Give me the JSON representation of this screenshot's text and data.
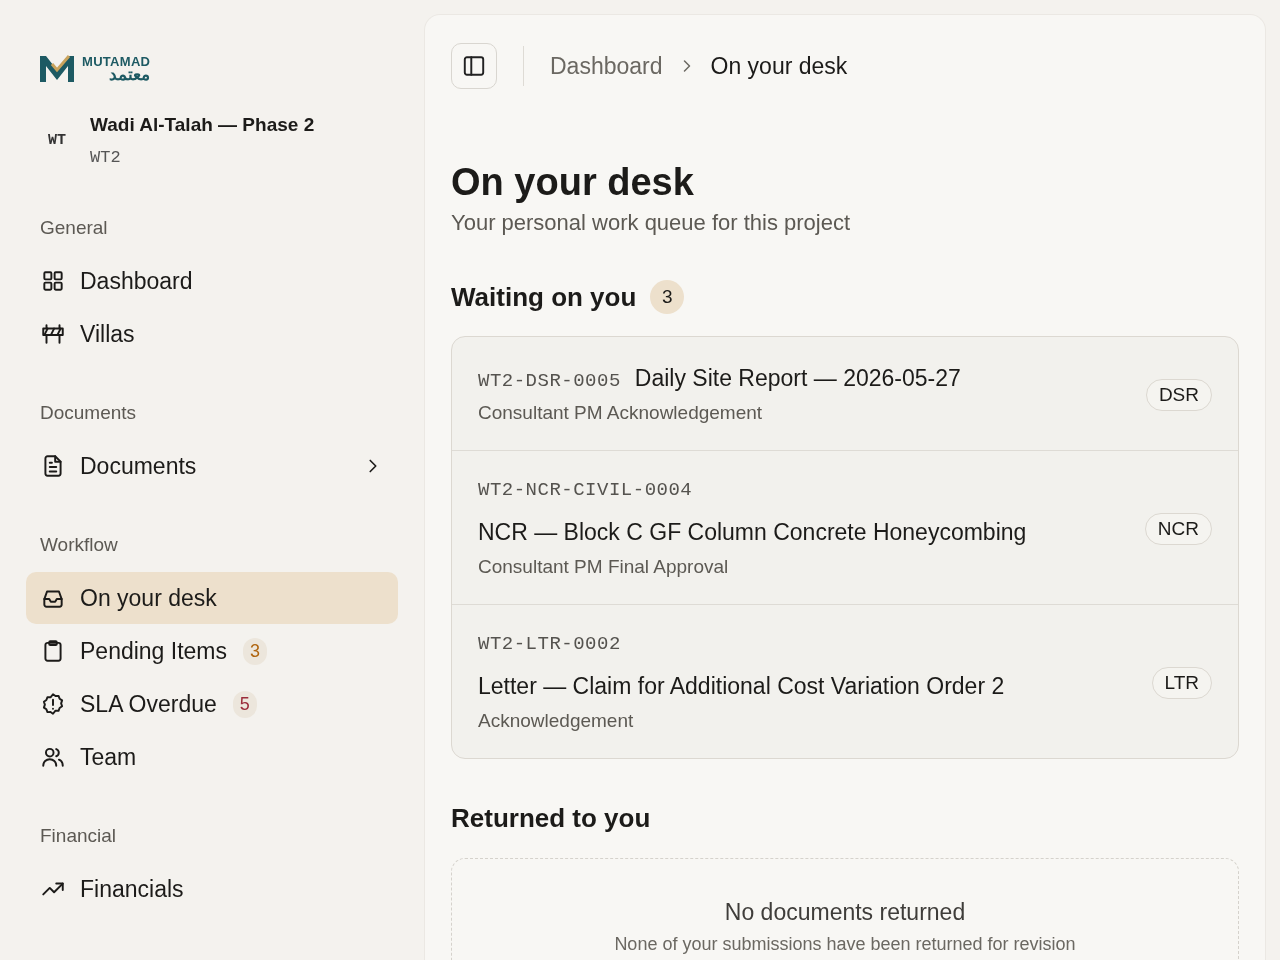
{
  "logo": {
    "wordmark": "MUTAMAD",
    "arabic": "معتمد"
  },
  "project": {
    "initials": "WT",
    "name": "Wadi Al-Talah — Phase 2",
    "code": "WT2"
  },
  "sidebar": {
    "sections": [
      {
        "title": "General",
        "items": [
          {
            "label": "Dashboard",
            "selected": false
          },
          {
            "label": "Villas",
            "selected": false
          }
        ]
      },
      {
        "title": "Documents",
        "items": [
          {
            "label": "Documents",
            "selected": false,
            "expanded": false
          }
        ]
      },
      {
        "title": "Workflow",
        "items": [
          {
            "label": "On your desk",
            "selected": true
          },
          {
            "label": "Pending Items",
            "selected": false,
            "badge": "3",
            "color": "#b0650f"
          },
          {
            "label": "SLA Overdue",
            "selected": false,
            "badge": "5",
            "color": "#9b2c3a"
          },
          {
            "label": "Team",
            "selected": false
          }
        ]
      },
      {
        "title": "Financial",
        "items": [
          {
            "label": "Financials",
            "selected": false
          }
        ]
      }
    ]
  },
  "breadcrumb": [
    {
      "label": "Dashboard",
      "current": false
    },
    {
      "label": "On your desk",
      "current": true
    }
  ],
  "page": {
    "title": "On your desk",
    "subtitle": "Your personal work queue for this project"
  },
  "waiting": {
    "title": "Waiting on you",
    "count": "3",
    "rows": [
      {
        "code": "WT2-DSR-0005",
        "title": "Daily Site Report — 2026-05-27",
        "step": "Consultant PM Acknowledgement",
        "tag": "DSR"
      },
      {
        "code": "WT2-NCR-CIVIL-0004",
        "title": "NCR — Block C GF Column Concrete Honeycombing",
        "step": "Consultant PM Final Approval",
        "tag": "NCR"
      },
      {
        "code": "WT2-LTR-0002",
        "title": "Letter — Claim for Additional Cost Variation Order 2",
        "step": "Acknowledgement",
        "tag": "LTR"
      }
    ]
  },
  "returned": {
    "title": "Returned to you",
    "empty_title": "No documents returned",
    "empty_text": "None of your submissions have been returned for revision"
  }
}
